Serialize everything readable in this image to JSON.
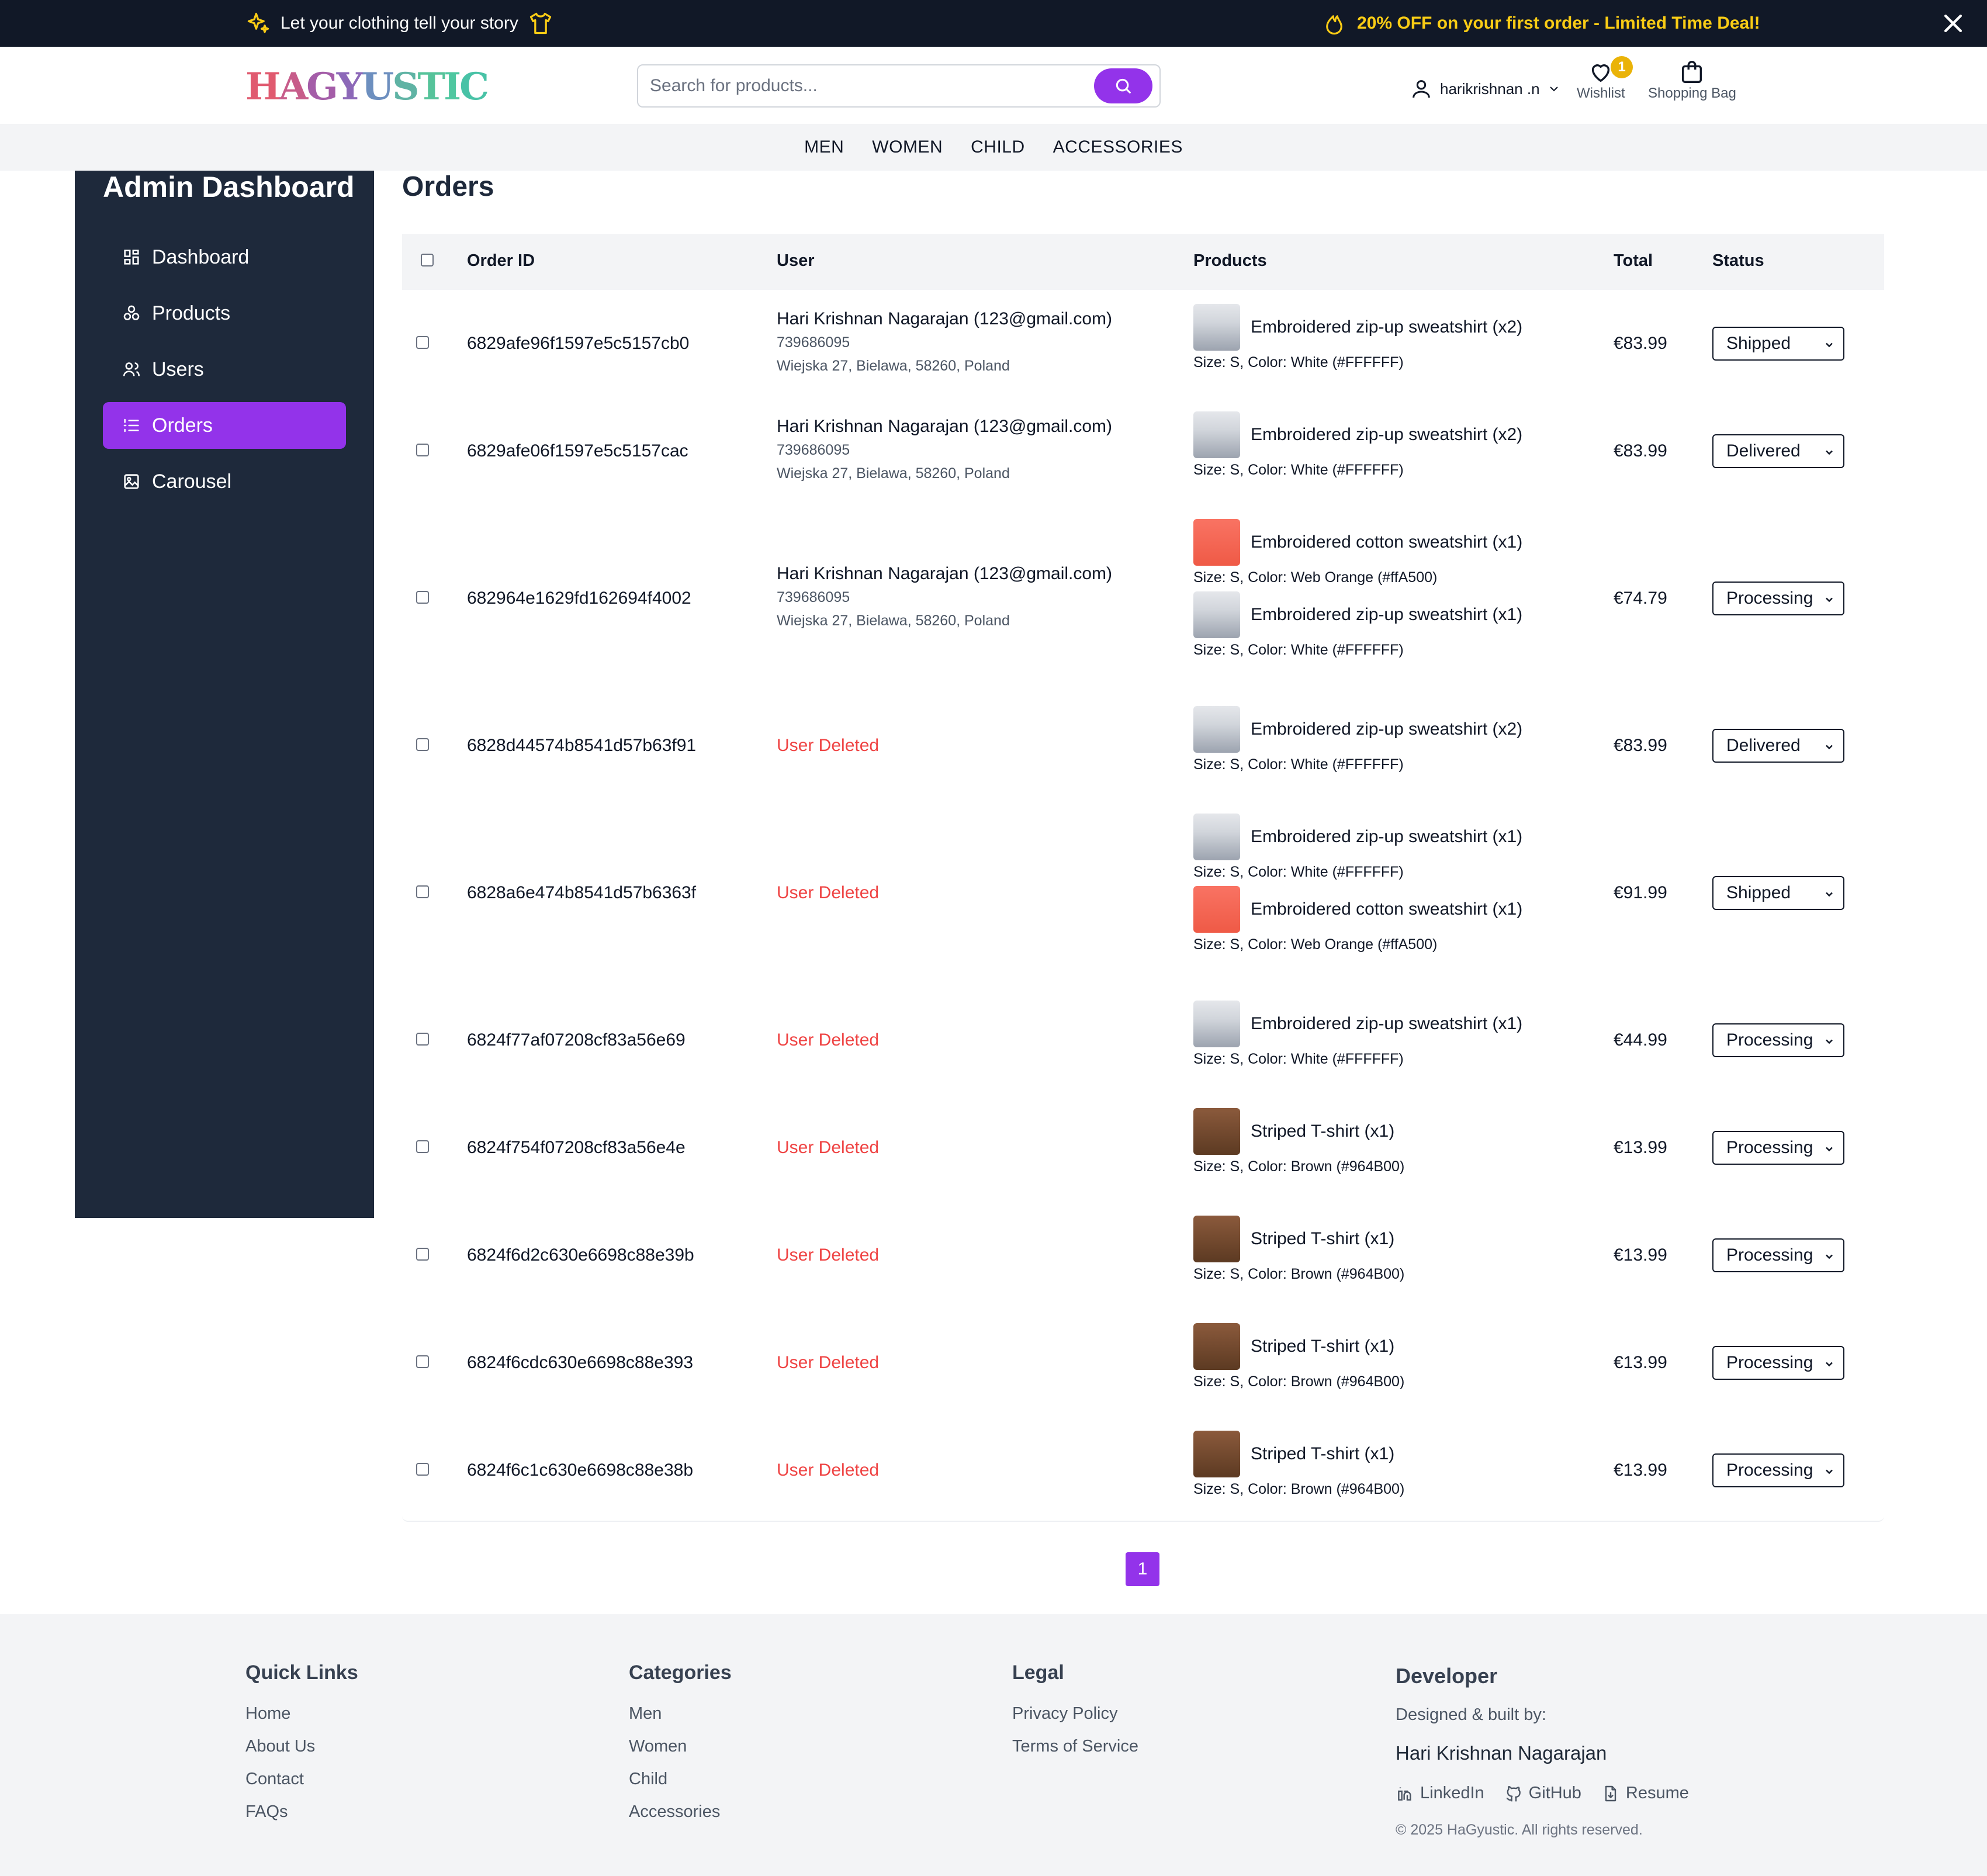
{
  "topbar": {
    "tagline": "Let your clothing tell your story",
    "promo": "20% OFF on your first order - Limited Time Deal!"
  },
  "header": {
    "logo": "HAGYUSTIC",
    "search_placeholder": "Search for products...",
    "username": "harikrishnan .n",
    "wishlist_label": "Wishlist",
    "wishlist_count": "1",
    "bag_label": "Shopping Bag"
  },
  "nav": [
    "MEN",
    "WOMEN",
    "CHILD",
    "ACCESSORIES"
  ],
  "sidebar": {
    "title": "Admin Dashboard",
    "items": [
      {
        "label": "Dashboard",
        "icon": "dashboard-icon"
      },
      {
        "label": "Products",
        "icon": "products-icon"
      },
      {
        "label": "Users",
        "icon": "users-icon"
      },
      {
        "label": "Orders",
        "icon": "orders-icon",
        "active": true
      },
      {
        "label": "Carousel",
        "icon": "image-icon"
      }
    ]
  },
  "main": {
    "title": "Orders",
    "columns": [
      "Order ID",
      "User",
      "Products",
      "Total",
      "Status"
    ],
    "status_options": [
      "Processing",
      "Shipped",
      "Delivered"
    ],
    "orders": [
      {
        "id": "6829afe96f1597e5c5157cb0",
        "user": {
          "name": "Hari Krishnan Nagarajan (123@gmail.com)",
          "phone": "739686095",
          "address": "Wiejska 27, Bielawa, 58260, Poland"
        },
        "products": [
          {
            "name": "Embroidered zip-up sweatshirt (x2)",
            "meta": "Size: S, Color: White (#FFFFFF)",
            "thumb": "white"
          }
        ],
        "total": "€83.99",
        "status": "Shipped"
      },
      {
        "id": "6829afe06f1597e5c5157cac",
        "user": {
          "name": "Hari Krishnan Nagarajan (123@gmail.com)",
          "phone": "739686095",
          "address": "Wiejska 27, Bielawa, 58260, Poland"
        },
        "products": [
          {
            "name": "Embroidered zip-up sweatshirt (x2)",
            "meta": "Size: S, Color: White (#FFFFFF)",
            "thumb": "white"
          }
        ],
        "total": "€83.99",
        "status": "Delivered"
      },
      {
        "id": "682964e1629fd162694f4002",
        "user": {
          "name": "Hari Krishnan Nagarajan (123@gmail.com)",
          "phone": "739686095",
          "address": "Wiejska 27, Bielawa, 58260, Poland"
        },
        "products": [
          {
            "name": "Embroidered cotton sweatshirt (x1)",
            "meta": "Size: S, Color: Web Orange (#ffA500)",
            "thumb": "orange"
          },
          {
            "name": "Embroidered zip-up sweatshirt (x1)",
            "meta": "Size: S, Color: White (#FFFFFF)",
            "thumb": "white"
          }
        ],
        "total": "€74.79",
        "status": "Processing"
      },
      {
        "id": "6828d44574b8541d57b63f91",
        "user_deleted": "User Deleted",
        "products": [
          {
            "name": "Embroidered zip-up sweatshirt (x2)",
            "meta": "Size: S, Color: White (#FFFFFF)",
            "thumb": "white"
          }
        ],
        "total": "€83.99",
        "status": "Delivered"
      },
      {
        "id": "6828a6e474b8541d57b6363f",
        "user_deleted": "User Deleted",
        "products": [
          {
            "name": "Embroidered zip-up sweatshirt (x1)",
            "meta": "Size: S, Color: White (#FFFFFF)",
            "thumb": "white"
          },
          {
            "name": "Embroidered cotton sweatshirt (x1)",
            "meta": "Size: S, Color: Web Orange (#ffA500)",
            "thumb": "orange"
          }
        ],
        "total": "€91.99",
        "status": "Shipped"
      },
      {
        "id": "6824f77af07208cf83a56e69",
        "user_deleted": "User Deleted",
        "products": [
          {
            "name": "Embroidered zip-up sweatshirt (x1)",
            "meta": "Size: S, Color: White (#FFFFFF)",
            "thumb": "white"
          }
        ],
        "total": "€44.99",
        "status": "Processing"
      },
      {
        "id": "6824f754f07208cf83a56e4e",
        "user_deleted": "User Deleted",
        "products": [
          {
            "name": "Striped T-shirt (x1)",
            "meta": "Size: S, Color: Brown (#964B00)",
            "thumb": "brown"
          }
        ],
        "total": "€13.99",
        "status": "Processing"
      },
      {
        "id": "6824f6d2c630e6698c88e39b",
        "user_deleted": "User Deleted",
        "products": [
          {
            "name": "Striped T-shirt (x1)",
            "meta": "Size: S, Color: Brown (#964B00)",
            "thumb": "brown"
          }
        ],
        "total": "€13.99",
        "status": "Processing"
      },
      {
        "id": "6824f6cdc630e6698c88e393",
        "user_deleted": "User Deleted",
        "products": [
          {
            "name": "Striped T-shirt (x1)",
            "meta": "Size: S, Color: Brown (#964B00)",
            "thumb": "brown"
          }
        ],
        "total": "€13.99",
        "status": "Processing"
      },
      {
        "id": "6824f6c1c630e6698c88e38b",
        "user_deleted": "User Deleted",
        "products": [
          {
            "name": "Striped T-shirt (x1)",
            "meta": "Size: S, Color: Brown (#964B00)",
            "thumb": "brown"
          }
        ],
        "total": "€13.99",
        "status": "Processing"
      }
    ],
    "page": "1"
  },
  "footer": {
    "quick_links": {
      "title": "Quick Links",
      "items": [
        "Home",
        "About Us",
        "Contact",
        "FAQs"
      ]
    },
    "categories": {
      "title": "Categories",
      "items": [
        "Men",
        "Women",
        "Child",
        "Accessories"
      ]
    },
    "legal": {
      "title": "Legal",
      "items": [
        "Privacy Policy",
        "Terms of Service"
      ]
    },
    "developer": {
      "title": "Developer",
      "subtitle": "Designed & built by:",
      "name": "Hari Krishnan Nagarajan",
      "links": [
        "LinkedIn",
        "GitHub",
        "Resume"
      ],
      "copyright": "© 2025 HaGyustic. All rights reserved."
    }
  },
  "colors": {
    "accent": "#9333ea",
    "sidebar_bg": "#1e293b",
    "topbar_bg": "#111827",
    "promo": "#facc15",
    "deleted": "#ef4444",
    "badge": "#eab308"
  }
}
